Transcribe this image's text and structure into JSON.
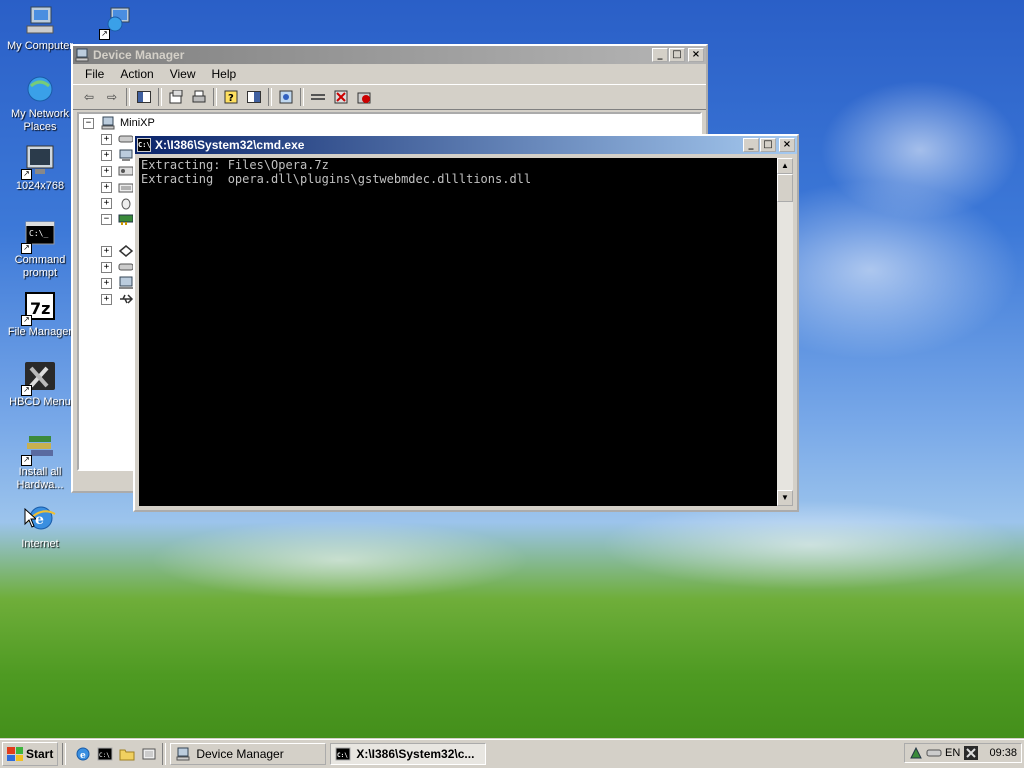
{
  "desktop": {
    "icons": [
      {
        "label": "My Computer",
        "icon": "my-computer-icon"
      },
      {
        "label": "My Network Places",
        "icon": "network-places-icon"
      },
      {
        "label": "1024x768",
        "icon": "display-icon"
      },
      {
        "label": "Command prompt",
        "icon": "command-prompt-icon"
      },
      {
        "label": "File Manager",
        "icon": "7zip-icon"
      },
      {
        "label": "HBCD Menu",
        "icon": "tools-icon"
      },
      {
        "label": "Install all Hardwa...",
        "icon": "install-hardware-icon"
      },
      {
        "label": "Internet",
        "icon": "internet-icon"
      }
    ]
  },
  "device_manager": {
    "title": "Device Manager",
    "menu": [
      "File",
      "Action",
      "View",
      "Help"
    ],
    "tree_root": "MiniXP"
  },
  "cmd": {
    "title": "X:\\I386\\System32\\cmd.exe",
    "icon_text": "C:\\",
    "lines": [
      "Extracting: Files\\Opera.7z",
      "Extracting  opera.dll\\plugins\\gstwebmdec.dllltions.dll"
    ]
  },
  "taskbar": {
    "start_label": "Start",
    "tasks": [
      {
        "label": "Device Manager",
        "active": false
      },
      {
        "label": "X:\\I386\\System32\\c...",
        "active": true
      }
    ],
    "tray": {
      "language": "EN",
      "clock": "09:38"
    }
  },
  "colors": {
    "active_title": "#0a246a",
    "inactive_title": "#808080",
    "console_bg": "#000000",
    "console_fg": "#c0c0c0"
  }
}
